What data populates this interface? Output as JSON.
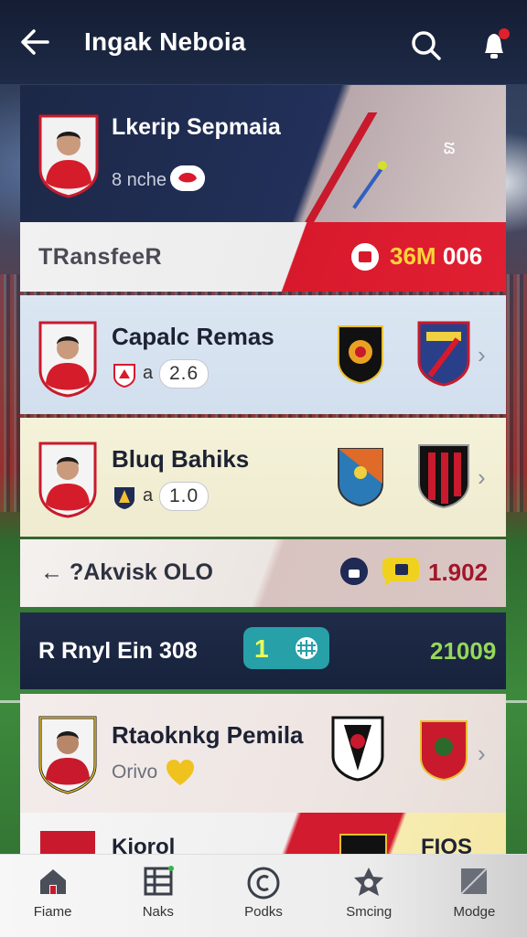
{
  "header": {
    "title": "Ingak Neboia"
  },
  "featured": {
    "name": "Lkerip Sepmaia",
    "sub": "8 nche"
  },
  "transfer": {
    "label": "TRansfeeR",
    "amount_highlight": "36M",
    "amount_suffix": "006"
  },
  "players": [
    {
      "name": "Capalc Remas",
      "a": "a",
      "rating": "2.6"
    },
    {
      "name": "Bluq Bahiks",
      "a": "a",
      "rating": "1.0"
    }
  ],
  "transfer_back": {
    "label": "← ?Akvisk OLO",
    "value": "1.902"
  },
  "ranking": {
    "label": "R Rnyl Ein 308",
    "position": "1",
    "value": "21009"
  },
  "ranking_player": {
    "name": "Rtaoknkg Pemila",
    "sub": "Orivo"
  },
  "partial_row": {
    "name": "Kiorol",
    "code": "FIOS"
  },
  "nav": {
    "items": [
      {
        "label": "Fiame",
        "icon": "home-icon"
      },
      {
        "label": "Naks",
        "icon": "table-icon"
      },
      {
        "label": "Podks",
        "icon": "ball-icon"
      },
      {
        "label": "Smcing",
        "icon": "star-badge-icon"
      },
      {
        "label": "Modge",
        "icon": "square-icon"
      }
    ]
  },
  "colors": {
    "header_bg": "#1e2a47",
    "accent_red": "#d8192c",
    "accent_yellow": "#ffd23a",
    "accent_green": "#96d85a",
    "teal": "#27a0a8"
  }
}
